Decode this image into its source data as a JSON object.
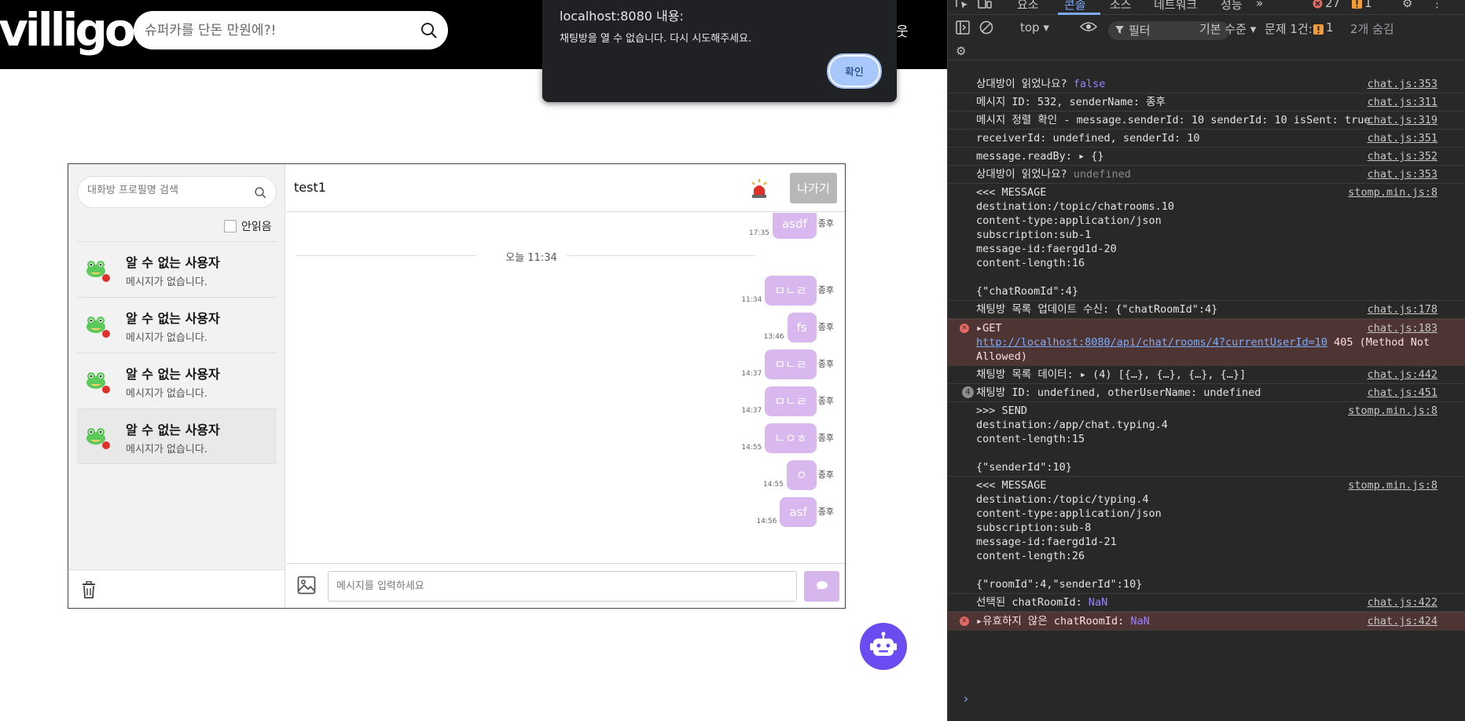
{
  "header": {
    "logo": "villigo",
    "search_placeholder": "슈퍼카를 단돈 만원에?!",
    "right_text": "웃"
  },
  "alert": {
    "origin": "localhost:8080 내용:",
    "message": "채팅방을 열 수 없습니다. 다시 시도해주세요.",
    "ok_label": "확인"
  },
  "sidebar": {
    "search_placeholder": "대화방 프로필명 검색",
    "unread_label": "안읽음",
    "rooms": [
      {
        "name": "알 수 없는 사용자",
        "preview": "메시지가 없습니다."
      },
      {
        "name": "알 수 없는 사용자",
        "preview": "메시지가 없습니다."
      },
      {
        "name": "알 수 없는 사용자",
        "preview": "메시지가 없습니다."
      },
      {
        "name": "알 수 없는 사용자",
        "preview": "메시지가 없습니다."
      }
    ]
  },
  "chat": {
    "title": "test1",
    "leave_label": "나가기",
    "date_divider": "오늘 11:34",
    "input_placeholder": "메시지를 입력하세요",
    "messages": [
      {
        "text": "asdf",
        "time": "17:35",
        "sender": "종후"
      },
      {
        "text": "ㅁㄴㄹ",
        "time": "11:34",
        "sender": "종후"
      },
      {
        "text": "fs",
        "time": "13:46",
        "sender": "종후"
      },
      {
        "text": "ㅁㄴㄹ",
        "time": "14:37",
        "sender": "종후"
      },
      {
        "text": "ㅁㄴㄹ",
        "time": "14:37",
        "sender": "종후"
      },
      {
        "text": "ㄴㅇㅎ",
        "time": "14:55",
        "sender": "종후"
      },
      {
        "text": "ㅇ",
        "time": "14:55",
        "sender": "종후"
      },
      {
        "text": "asf",
        "time": "14:56",
        "sender": "종후"
      }
    ]
  },
  "devtools": {
    "tabs": [
      "요소",
      "콘솔",
      "소스",
      "네트워크",
      "성능"
    ],
    "active_tab": "콘솔",
    "error_count": "27",
    "warning_count": "1",
    "context": "top",
    "filter": "필터",
    "level": "기본 수준",
    "issues": "문제 1건:",
    "issues_count": "1",
    "hidden": "2개 숨김",
    "logs": [
      {
        "text": "상대방이 읽었나요? ",
        "value": "false",
        "value_style": "purple",
        "src": "chat.js:353"
      },
      {
        "text": "메시지 ID: 532, senderName: 종후",
        "src": "chat.js:311"
      },
      {
        "text": "메시지 정렬 확인 - message.senderId: 10 senderId: 10 isSent: true",
        "src": "chat.js:319"
      },
      {
        "text": "receiverId: undefined, senderId: 10",
        "src": "chat.js:351"
      },
      {
        "text": "message.readBy: ▸ {}",
        "src": "chat.js:352"
      },
      {
        "text": "상대방이 읽었나요? ",
        "value": "undefined",
        "value_style": "gray",
        "src": "chat.js:353"
      },
      {
        "text": "<<< MESSAGE\ndestination:/topic/chatrooms.10\ncontent-type:application/json\nsubscription:sub-1\nmessage-id:faergd1d-20\ncontent-length:16\n\n{\"chatRoomId\":4}",
        "src": "stomp.min.js:8"
      },
      {
        "text": "채팅방 목록 업데이트 수신: {\"chatRoomId\":4}",
        "src": "chat.js:178"
      },
      {
        "type": "error",
        "text": "▸GET",
        "link": "http://localhost:8080/api/chat/rooms/4?currentUserId=10",
        "tail": " 405 (Method Not Allowed)",
        "src": "chat.js:183"
      },
      {
        "text": "채팅방 목록 데이터: ▸ (4) [{…}, {…}, {…}, {…}]",
        "src": "chat.js:442"
      },
      {
        "text": "채팅방 ID: undefined, otherUserName: undefined",
        "badge": "4",
        "src": "chat.js:451"
      },
      {
        "text": ">>> SEND\ndestination:/app/chat.typing.4\ncontent-length:15\n\n{\"senderId\":10}",
        "src": "stomp.min.js:8"
      },
      {
        "text": "<<< MESSAGE\ndestination:/topic/typing.4\ncontent-type:application/json\nsubscription:sub-8\nmessage-id:faergd1d-21\ncontent-length:26\n\n{\"roomId\":4,\"senderId\":10}",
        "src": "stomp.min.js:8"
      },
      {
        "text": "선택된 chatRoomId: ",
        "value": "NaN",
        "value_style": "purple",
        "src": "chat.js:422"
      },
      {
        "type": "error",
        "text": "▸유효하지 않은 chatRoomId: ",
        "value": "NaN",
        "value_style": "purple",
        "src": "chat.js:424"
      }
    ]
  }
}
